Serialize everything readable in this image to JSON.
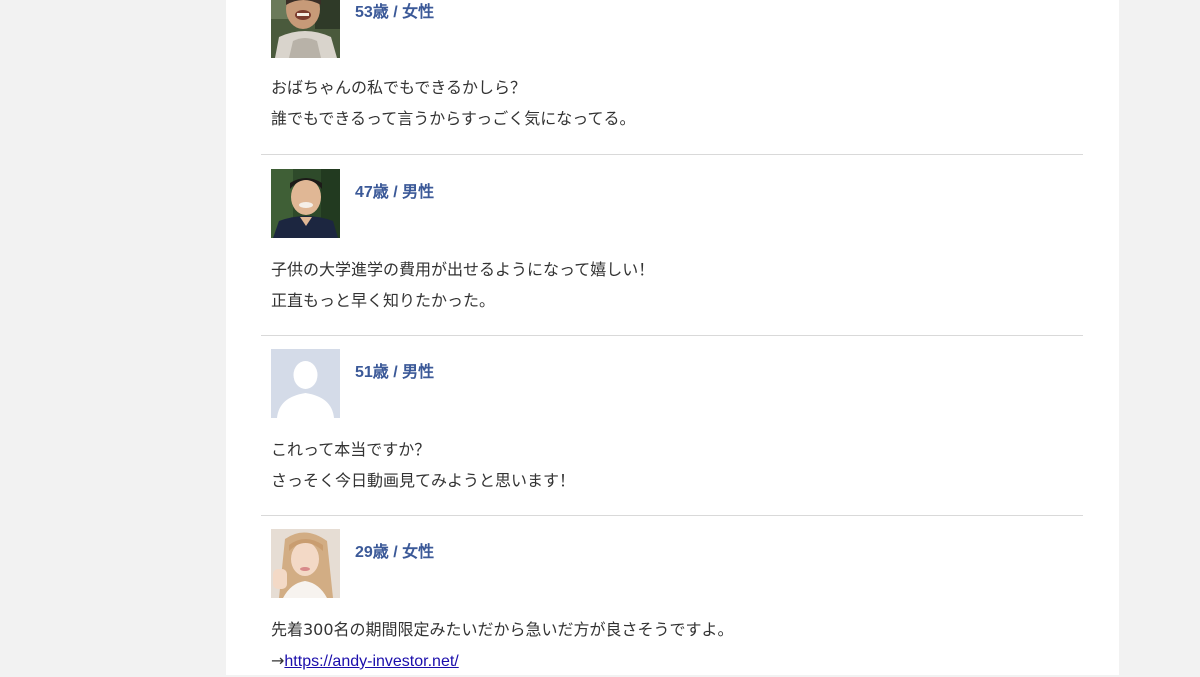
{
  "comments": [
    {
      "meta": "53歳 / 女性",
      "lines": [
        "おばちゃんの私でもできるかしら？",
        "誰でもできるって言うからすっごく気になってる。"
      ],
      "avatar": "photo-elderly-woman-laughing"
    },
    {
      "meta": "47歳 / 男性",
      "lines": [
        "子供の大学進学の費用が出せるようになって嬉しい！",
        "正直もっと早く知りたかった。"
      ],
      "avatar": "photo-smiling-man"
    },
    {
      "meta": "51歳 / 男性",
      "lines": [
        "これって本当ですか？",
        "さっそく今日動画見てみようと思います！"
      ],
      "avatar": "default-person-silhouette"
    },
    {
      "meta": "29歳 / 女性",
      "lines": [
        "先着300名の期間限定みたいだから急いだ方が良さそうですよ。"
      ],
      "link_prefix": "→",
      "link": "https://andy-investor.net/",
      "avatar": "photo-young-woman"
    }
  ],
  "colors": {
    "meta": "#3b5998",
    "text": "#333333",
    "link": "#1a0dab",
    "divider": "#d9d9d9",
    "page_bg": "#f2f2f2"
  }
}
